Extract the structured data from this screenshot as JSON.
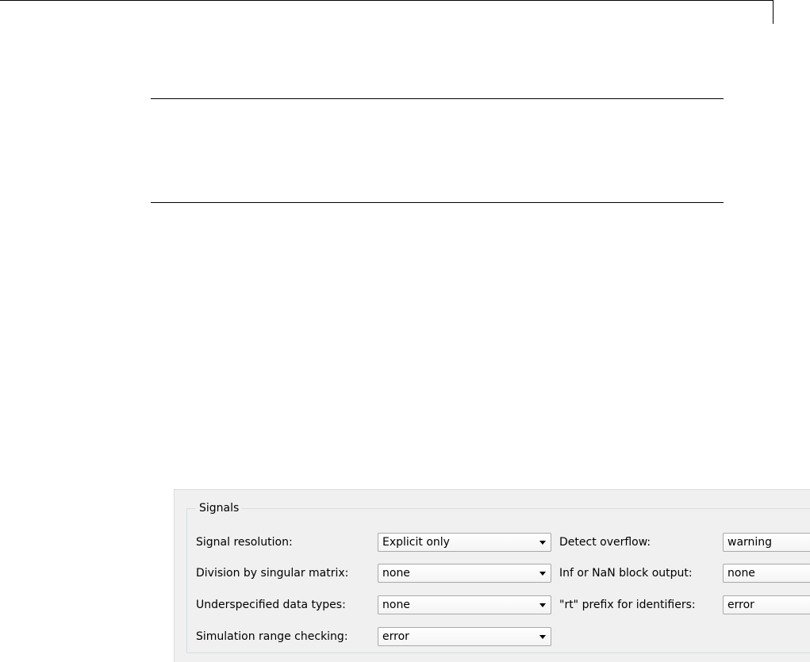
{
  "signals_panel": {
    "group_title": "Signals",
    "left_fields": [
      {
        "label": "Signal resolution:",
        "value": "Explicit only"
      },
      {
        "label": "Division by singular matrix:",
        "value": "none"
      },
      {
        "label": "Underspecified data types:",
        "value": "none"
      },
      {
        "label": "Simulation range checking:",
        "value": "error"
      }
    ],
    "right_fields": [
      {
        "label": "Detect overflow:",
        "value": "warning"
      },
      {
        "label": "Inf or NaN block output:",
        "value": "none"
      },
      {
        "label": "\"rt\" prefix for identifiers:",
        "value": "error"
      }
    ]
  },
  "icons": {
    "dropdown": "chevron-down-icon"
  }
}
